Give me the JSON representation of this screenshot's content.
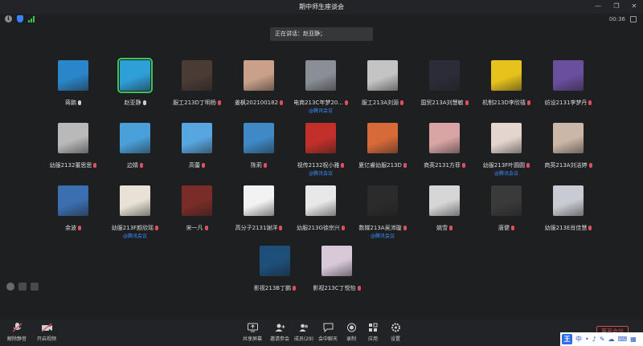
{
  "window": {
    "title": "期中师生座谈会",
    "minimize": "—",
    "restore": "❐",
    "close": "✕",
    "timer": "00:36"
  },
  "speaking_banner": "正在讲话：赵亚静；",
  "participants": [
    {
      "name": "蒋鹏",
      "mic": "on",
      "via": ""
    },
    {
      "name": "赵亚静",
      "mic": "on",
      "via": "",
      "active": true
    },
    {
      "name": "服工213D丁明杨",
      "mic": "off",
      "via": ""
    },
    {
      "name": "姜枫202100182",
      "mic": "off",
      "via": ""
    },
    {
      "name": "电商213C年梦20...",
      "mic": "off",
      "via": "@腾讯会议"
    },
    {
      "name": "服工213A刘源",
      "mic": "off",
      "via": ""
    },
    {
      "name": "国贸213A刘慧敏",
      "mic": "off",
      "via": ""
    },
    {
      "name": "机制213D李欣禧",
      "mic": "off",
      "via": ""
    },
    {
      "name": "纺设2131李梦丹",
      "mic": "off",
      "via": ""
    },
    {
      "name": "幼服2132董思思",
      "mic": "off",
      "via": ""
    },
    {
      "name": "边婧",
      "mic": "off",
      "via": ""
    },
    {
      "name": "高蕾",
      "mic": "off",
      "via": ""
    },
    {
      "name": "陈莉",
      "mic": "off",
      "via": ""
    },
    {
      "name": "视传2132祝小雅",
      "mic": "off",
      "via": "@腾讯会议"
    },
    {
      "name": "夏亿睿幼服213D",
      "mic": "off",
      "via": ""
    },
    {
      "name": "商英2131方菲",
      "mic": "off",
      "via": ""
    },
    {
      "name": "幼服213F叶圆圆",
      "mic": "off",
      "via": "@腾讯会议"
    },
    {
      "name": "商英213A刘洁婷",
      "mic": "off",
      "via": ""
    },
    {
      "name": "余波",
      "mic": "off",
      "via": ""
    },
    {
      "name": "幼服213F颜欣瑶",
      "mic": "off",
      "via": "@腾讯会议"
    },
    {
      "name": "宋一凡",
      "mic": "off",
      "via": ""
    },
    {
      "name": "高分子2131谢洋",
      "mic": "off",
      "via": ""
    },
    {
      "name": "幼服213G徐宗兴",
      "mic": "off",
      "via": ""
    },
    {
      "name": "数媒213A吴沛璇",
      "mic": "off",
      "via": "@腾讯会议"
    },
    {
      "name": "姚雪",
      "mic": "off",
      "via": ""
    },
    {
      "name": "唐健",
      "mic": "off",
      "via": ""
    },
    {
      "name": "幼服213E肖佳慧",
      "mic": "off",
      "via": ""
    },
    {
      "name": "影视213B丁鹏",
      "mic": "off",
      "via": ""
    },
    {
      "name": "影视213C丁悦怡",
      "mic": "off",
      "via": ""
    }
  ],
  "avatar_colors": [
    "#2a86c8",
    "#2f9fd8",
    "#4a3b35",
    "#c9a08a",
    "#8a8f96",
    "#c4c4c4",
    "#2c2c38",
    "#e8c21c",
    "#6a4f9e",
    "#b9b9b9",
    "#4aa0d8",
    "#58a6e0",
    "#3e89c6",
    "#c3302a",
    "#d86a3a",
    "#d8a4a4",
    "#e4d6cf",
    "#cbb7a8",
    "#3a6fb0",
    "#e8e2d6",
    "#7a2c28",
    "#f2f2f2",
    "#e8e8e8",
    "#2b2b2b",
    "#d6d6d6",
    "#3a3a3a",
    "#c8ccd2",
    "#1d4f7a",
    "#d8c8d8"
  ],
  "toolbar": {
    "mute": "解除静音",
    "video": "开启视频",
    "share": "共享屏幕",
    "invite": "邀请参会",
    "members": "成员(29)",
    "chat": "会中聊天",
    "record": "录制",
    "apps": "应用",
    "settings": "设置",
    "leave": "离开会议"
  },
  "ime": {
    "logo": "王",
    "mode": "中"
  }
}
